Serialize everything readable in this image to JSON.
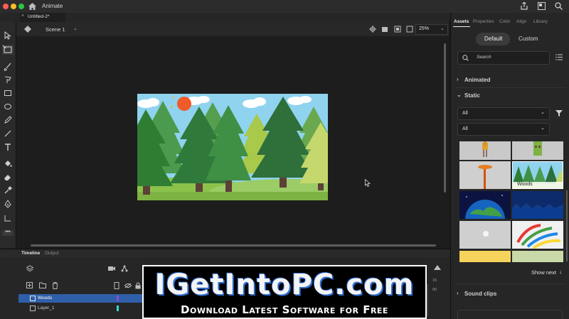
{
  "app": {
    "name": "Animate",
    "doc_tab": "Untitled-2*"
  },
  "scene": {
    "label": "Scene 1",
    "zoom": "25%"
  },
  "timeline": {
    "tabs": [
      "Timeline",
      "Output"
    ],
    "layers": [
      {
        "name": "Woods",
        "selected": true,
        "color": "#8f4bd6"
      },
      {
        "name": "Layer_1",
        "selected": false,
        "color": "#35d6d6"
      }
    ],
    "frame_numbers": [
      "15",
      "90"
    ]
  },
  "panel": {
    "tabs": [
      "Assets",
      "Properties",
      "Color",
      "Align",
      "Library"
    ],
    "mode_buttons": [
      "Default",
      "Custom"
    ],
    "search_placeholder": "Search",
    "sections": {
      "animated": "Animated",
      "static": "Static",
      "sound": "Sound clips"
    },
    "filters": [
      "All",
      "All"
    ],
    "thumb_label": "Woods",
    "show_next": "Show next"
  },
  "watermark": {
    "title": "IGetIntoPC.com",
    "subtitle": "Download Latest Software for Free"
  },
  "colors": {
    "accent_blue": "#1473e6",
    "panel_bg": "#262626",
    "fill_swatch": "#57d28f"
  }
}
